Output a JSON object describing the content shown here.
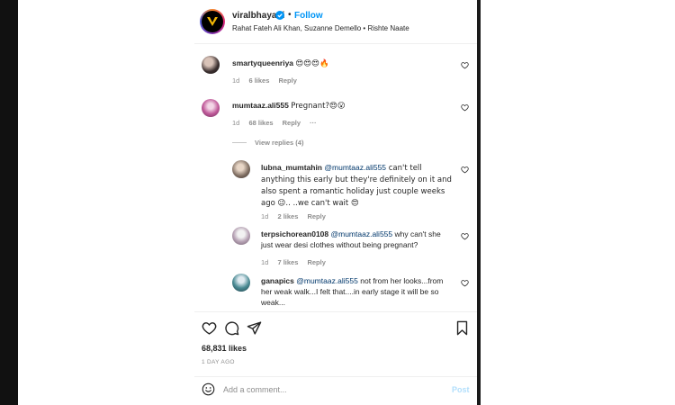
{
  "post_header": {
    "username": "viralbhayani",
    "follow_label": "Follow",
    "separator": "•",
    "subtitle": "Rahat Fateh Ali Khan, Suzanne Demello • Rishte Naate"
  },
  "comments": [
    {
      "username": "smartyqueenriya",
      "text": "😍😍😍🔥",
      "time": "1d",
      "likes": "6 likes",
      "reply_label": "Reply"
    },
    {
      "username": "mumtaaz.ali555",
      "text": "Pregnant?😍😮",
      "time": "1d",
      "likes": "68 likes",
      "reply_label": "Reply",
      "more": "···",
      "view_replies": "View replies (4)"
    }
  ],
  "replies": [
    {
      "username": "lubna_mumtahin",
      "mention": "@mumtaaz.ali555",
      "text": " can't tell anything this early but they're definitely on it and also spent a romantic holiday just couple weeks ago 😉.. ..we can't wait 😍",
      "time": "1d",
      "likes": "2 likes",
      "reply_label": "Reply"
    },
    {
      "username": "terpsichorean0108",
      "mention": "@mumtaaz.ali555",
      "text": " why can't she just wear desi clothes without being pregnant?",
      "time": "1d",
      "likes": "7 likes",
      "reply_label": "Reply"
    },
    {
      "username": "ganapics",
      "mention": "@mumtaaz.ali555",
      "text": " not from her looks...from her weak walk...I felt that....in early stage it will be so weak...",
      "time": "",
      "likes": "",
      "reply_label": ""
    }
  ],
  "post_footer": {
    "likes": "68,831 likes",
    "time_ago": "1 DAY AGO",
    "comment_placeholder": "Add a comment...",
    "post_label": "Post"
  },
  "colors": {
    "accent": "#0095f6",
    "mention": "#00376b",
    "muted": "#8e8e8e",
    "post_disabled": "#b2dffc"
  },
  "icons": [
    "verified-badge-icon",
    "heart-icon",
    "comment-icon",
    "share-icon",
    "bookmark-icon",
    "emoji-icon",
    "more-icon"
  ]
}
